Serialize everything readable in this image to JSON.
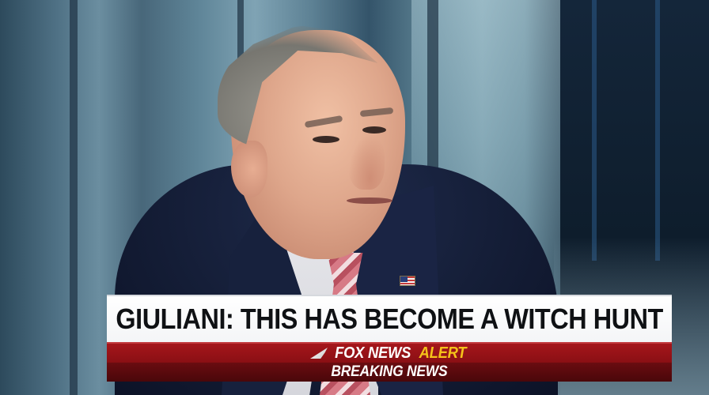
{
  "chyron": {
    "headline": "GIULIANI: THIS HAS BECOME A WITCH HUNT",
    "network_logo": "FOX NEWS",
    "alert_label": "ALERT",
    "breaking_label": "BREAKING NEWS"
  },
  "colors": {
    "alert_red": "#a5161b",
    "breaking_dark_red": "#5a090d",
    "alert_yellow": "#f5c21a",
    "headline_bg": "#ffffff",
    "headline_text": "#0f1114"
  },
  "icons": {
    "network_logo_mark": "fox-streak-icon",
    "lapel_pin": "american-flag-pin-icon"
  }
}
